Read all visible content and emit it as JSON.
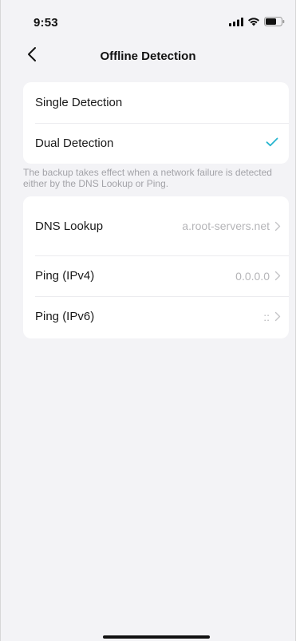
{
  "status_bar": {
    "time": "9:53",
    "icons": [
      "signal-icon",
      "wifi-icon",
      "battery-icon"
    ]
  },
  "nav": {
    "back_icon": "chevron-left-icon",
    "title": "Offline Detection"
  },
  "detection_mode": {
    "options": [
      {
        "label": "Single Detection",
        "selected": false
      },
      {
        "label": "Dual Detection",
        "selected": true
      }
    ],
    "check_color": "#27b5cf"
  },
  "info": {
    "text": "The backup takes effect when a network failure is detected either by the DNS Lookup or Ping."
  },
  "addresses": {
    "rows": [
      {
        "label": "DNS Lookup",
        "value": "a.root-servers.net"
      },
      {
        "label": "Ping (IPv4)",
        "value": "0.0.0.0"
      },
      {
        "label": "Ping (IPv6)",
        "value": "::"
      }
    ]
  }
}
